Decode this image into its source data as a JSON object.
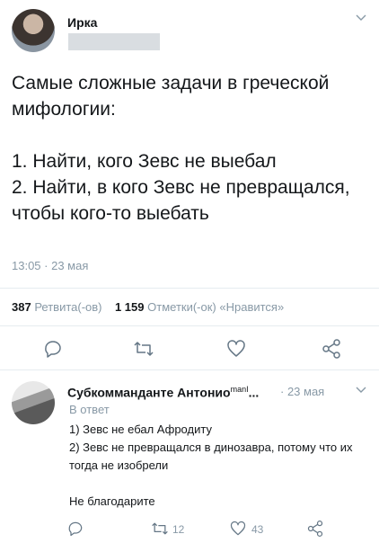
{
  "tweet": {
    "author_name": "Ирка",
    "text": "Самые сложные задачи в греческой мифологии:\n\n1. Найти, кого Зевс не выебал\n2. Найти, в кого Зевс не превращался, чтобы кого-то выебать",
    "time": "13:05 · 23 мая",
    "retweets_count": "387",
    "retweets_label": "Ретвита(-ов)",
    "likes_count": "1 159",
    "likes_label": "Отметки(-ок) «Нравится»",
    "actions": [
      "reply-icon",
      "retweet-icon",
      "like-icon",
      "share-icon"
    ]
  },
  "reply": {
    "author_name": "Субкомманданте Антонио",
    "author_suffix": "manI",
    "ellipsis": "...",
    "date": "· 23 мая",
    "reply_to": "В ответ",
    "text": "1) Зевс не ебал Афродиту\n2) Зевс не превращался в динозавра, потому что их тогда не изобрели\n\nНе благодарите",
    "retweets_count": "12",
    "likes_count": "43",
    "actions": [
      "reply-icon",
      "retweet-icon",
      "like-icon",
      "share-icon"
    ]
  },
  "colors": {
    "text": "#14171a",
    "muted": "#8899a6",
    "divider": "#e6ecf0"
  }
}
